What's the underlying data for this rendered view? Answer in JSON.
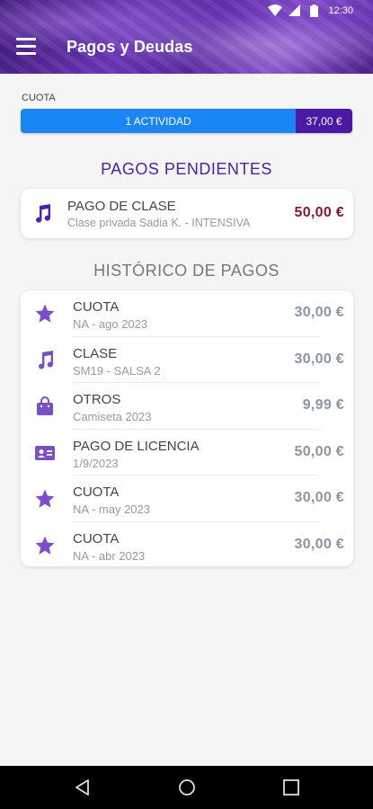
{
  "status_bar": {
    "time": "12:30"
  },
  "header": {
    "title": "Pagos y Deudas"
  },
  "cuota": {
    "label": "CUOTA",
    "activity_label": "1 ACTIVIDAD",
    "amount": "37,00 €",
    "colors": {
      "activity": "#1a85f5",
      "amount": "#4a1aa5"
    }
  },
  "pending": {
    "title": "PAGOS PENDIENTES",
    "items": [
      {
        "icon": "music-note-icon",
        "title": "PAGO DE CLASE",
        "subtitle": "Clase privada Sadia K. - INTENSIVA",
        "amount": "50,00 €"
      }
    ]
  },
  "history": {
    "title": "HISTÓRICO DE PAGOS",
    "items": [
      {
        "icon": "star-icon",
        "title": "CUOTA",
        "subtitle": "NA - ago 2023",
        "amount": "30,00 €"
      },
      {
        "icon": "music-note-icon",
        "title": "CLASE",
        "subtitle": "SM19 - SALSA 2",
        "amount": "30,00 €"
      },
      {
        "icon": "shopping-bag-icon",
        "title": "OTROS",
        "subtitle": "Camiseta 2023",
        "amount": "9,99 €"
      },
      {
        "icon": "id-card-icon",
        "title": "PAGO DE LICENCIA",
        "subtitle": "1/9/2023",
        "amount": "50,00 €"
      },
      {
        "icon": "star-icon",
        "title": "CUOTA",
        "subtitle": "NA - may 2023",
        "amount": "30,00 €"
      },
      {
        "icon": "star-icon",
        "title": "CUOTA",
        "subtitle": "NA - abr 2023",
        "amount": "30,00 €"
      }
    ]
  },
  "colors": {
    "accent": "#4b22a8",
    "icon": "#7b4fc9",
    "pending_amount": "#8a1538",
    "history_amount": "#8b95a3"
  }
}
